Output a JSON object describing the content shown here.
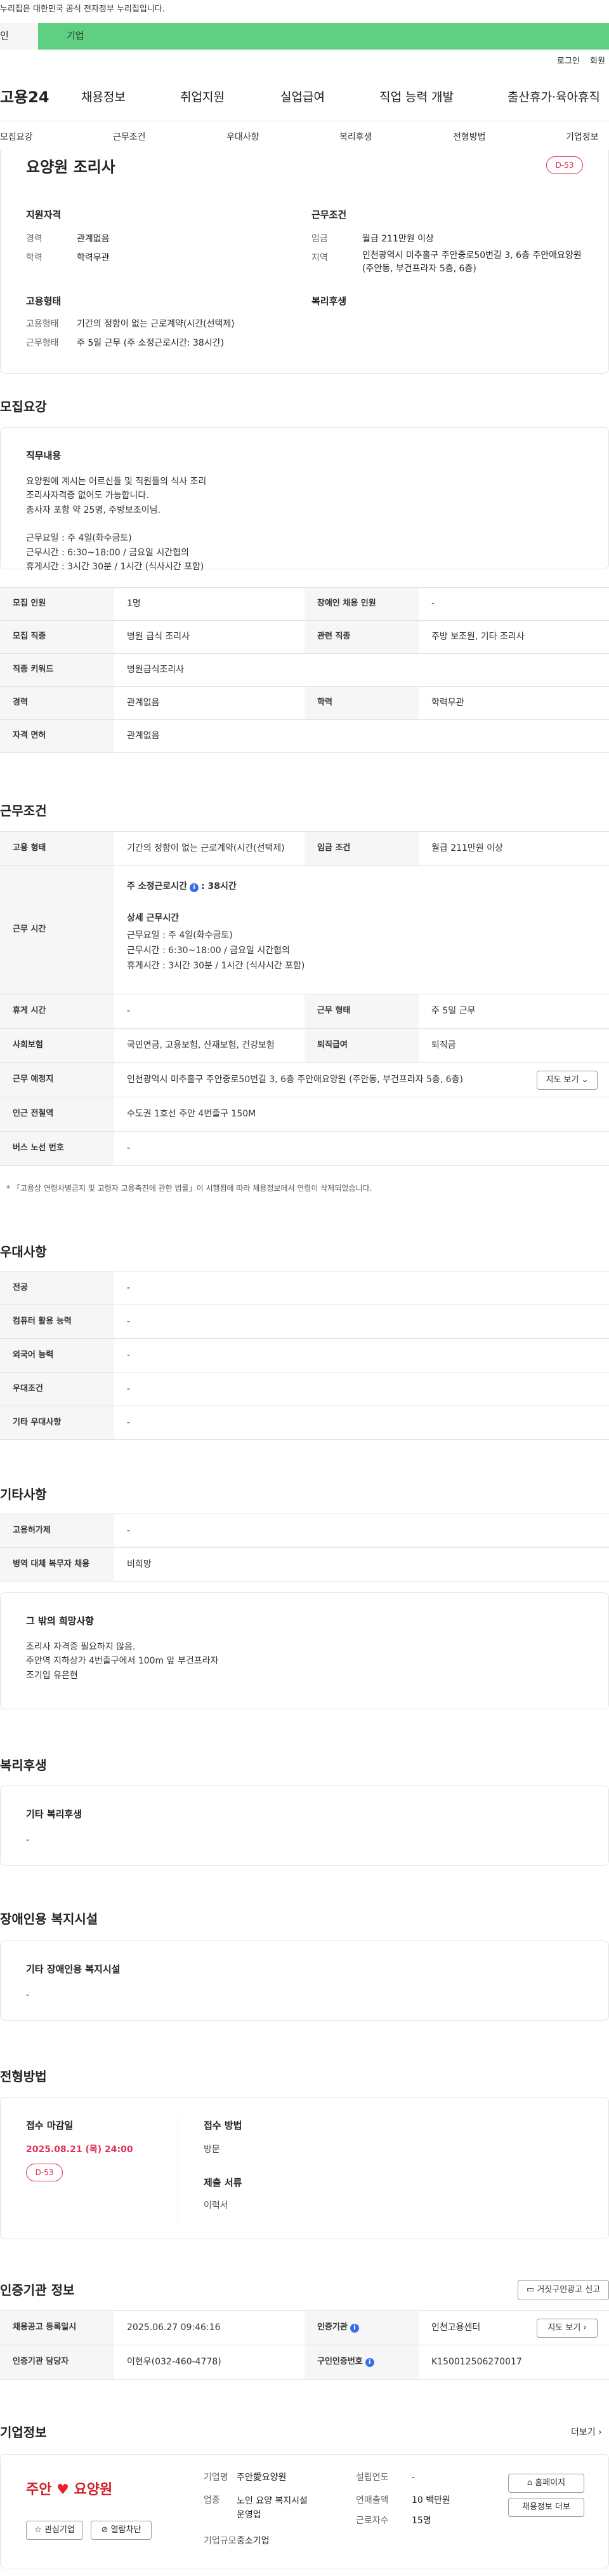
{
  "gov_notice": "누리집은 대한민국 공식 전자정부 누리집입니다.",
  "portal_tabs": [
    "인",
    "기업"
  ],
  "top_links": [
    "로그인",
    "회원"
  ],
  "brand": "고용24",
  "gnb": [
    "채용정보",
    "취업지원",
    "실업급여",
    "직업 능력 개발",
    "출산휴가·육아휴직"
  ],
  "anchors": [
    "모집요강",
    "근무조건",
    "우대사항",
    "복리후생",
    "전형방법",
    "기업정보"
  ],
  "summary": {
    "title": "요양원 조리사",
    "dday": "D-53",
    "qual_title": "지원자격",
    "career_label": "경력",
    "career": "관계없음",
    "edu_label": "학력",
    "edu": "학력무관",
    "cond_title": "근무조건",
    "wage_label": "임금",
    "wage": "월급 211만원 이상",
    "area_label": "지역",
    "area": "인천광역시 미추홀구 주안중로50번길 3, 6층 주안애요양원 (주안동, 부건프라자 5층, 6층)",
    "emp_title": "고용형태",
    "emp_label": "고용형태",
    "emp": "기간의 정함이 없는 근로계약(시간(선택제)",
    "work_label": "근무형태",
    "work": "주 5일 근무 (주 소정근로시간: 38시간)",
    "welfare_title": "복리후생"
  },
  "recruit": {
    "heading": "모집요강",
    "duty_title": "직무내용",
    "duty_body": "요양원에 계시는 어르신들 및 직원들의 식사 조리\n조리사자격증 없어도 가능합니다.\n총사자 포함 약 25명, 주방보조이님.\n\n근무요일 : 주 4일(화수금토)\n근무시간 : 6:30~18:00 / 금요일 시간협의\n휴게시간 : 3시간 30분 / 1시간 (식사시간 포함)",
    "rows": [
      {
        "k1": "모집 인원",
        "v1": "1명",
        "k2": "장애인 채용 인원",
        "v2": "-"
      },
      {
        "k1": "모집 직종",
        "v1": "병원 급식 조리사",
        "k2": "관련 직종",
        "v2": "주방 보조원, 기타 조리사"
      },
      {
        "k1": "직종 키워드",
        "v1": "병원급식조리사"
      },
      {
        "k1": "경력",
        "v1": "관계없음",
        "k2": "학력",
        "v2": "학력무관"
      },
      {
        "k1": "자격 면허",
        "v1": "관계없음"
      }
    ]
  },
  "work": {
    "heading": "근무조건",
    "emp_label": "고용 형태",
    "emp": "기간의 정함이 없는 근로계약(시간(선택제)",
    "wage_label": "임금 조건",
    "wage": "월급 211만원 이상",
    "hours_label": "근무 시간",
    "weekly_label": "주 소정근로시간",
    "weekly": ": 38시간",
    "detail_title": "상세 근무시간",
    "detail": "근무요일 : 주 4일(화수금토)\n근무시간 : 6:30~18:00 / 금요일 시간협의\n휴게시간 : 3시간 30분 / 1시간 (식사시간 포함)",
    "rest_label": "휴게 시간",
    "rest": "-",
    "form_label": "근무 형태",
    "form": "주 5일 근무",
    "ins_label": "사회보험",
    "ins": "국민연금, 고용보험, 산재보험, 건강보험",
    "sev_label": "퇴직급여",
    "sev": "퇴직금",
    "place_label": "근무 예정지",
    "place": "인천광역시 미추홀구 주안중로50번길 3, 6층 주안애요양원 (주안동, 부건프라자 5층, 6층)",
    "map_btn": "지도 보기",
    "subway_label": "인근 전철역",
    "subway": "수도권 1호선 주안 4번출구 150M",
    "bus_label": "버스 노선 번호",
    "bus": "-",
    "note": "* 「고용상 연령차별금지 및 고령자 고용촉진에 관한 법률」이 시행됨에 따라 채용정보에서 연령이 삭제되었습니다."
  },
  "pref": {
    "heading": "우대사항",
    "rows": [
      {
        "k": "전공",
        "v": "-"
      },
      {
        "k": "컴퓨터 활용 능력",
        "v": "-"
      },
      {
        "k": "외국어 능력",
        "v": "-"
      },
      {
        "k": "우대조건",
        "v": "-"
      },
      {
        "k": "기타 우대사항",
        "v": "-"
      }
    ]
  },
  "etc": {
    "heading": "기타사항",
    "rows": [
      {
        "k": "고용허가제",
        "v": "-"
      },
      {
        "k": "병역 대체 복무자 채용",
        "v": "비희망"
      }
    ],
    "box_title": "그 밖의 희망사항",
    "box_body": "조리사 자격증 필요하지 않음.\n주안역 지하상가 4번출구에서 100m 앞 부건프라자\n조기입 유은현"
  },
  "welfare": {
    "heading": "복리후생",
    "box_title": "기타 복리후생",
    "box_body": "-"
  },
  "disab": {
    "heading": "장애인용 복지시설",
    "box_title": "기타 장애인용 복지시설",
    "box_body": "-"
  },
  "selection": {
    "heading": "전형방법",
    "deadline_label": "접수 마감일",
    "deadline": "2025.08.21 (목) 24:00",
    "dday": "D-53",
    "method_label": "접수 방법",
    "method": "방문",
    "docs_label": "제출 서류",
    "docs": "이력서"
  },
  "cert": {
    "heading": "인증기관 정보",
    "report_btn": "거짓구인광고 신고",
    "reg_label": "채용공고 등록일시",
    "reg": "2025.06.27 09:46:16",
    "org_label": "인증기관",
    "org": "인천고용센터",
    "view_btn": "지도 보기",
    "mgr_label": "인증기관 담당자",
    "mgr": "이현우(032-460-4778)",
    "no_label": "구인인증번호",
    "no": "K150012506270017"
  },
  "company": {
    "heading": "기업정보",
    "more": "더보기",
    "logo_text": "주안",
    "logo_text2": "요양원",
    "fav_btn": "관심기업",
    "block_btn": "열람차단",
    "name_label": "기업명",
    "name": "주안愛요양원",
    "ind_label": "업종",
    "ind": "노인 요양 복지시설 운영업",
    "size_label": "기업규모",
    "size": "중소기업",
    "year_label": "설립연도",
    "year": "-",
    "sales_label": "연매출액",
    "sales": "10 백만원",
    "emp_label": "근로자수",
    "emp": "15명",
    "home_btn": "홈페이지",
    "jobs_btn": "채용정보 더보"
  }
}
